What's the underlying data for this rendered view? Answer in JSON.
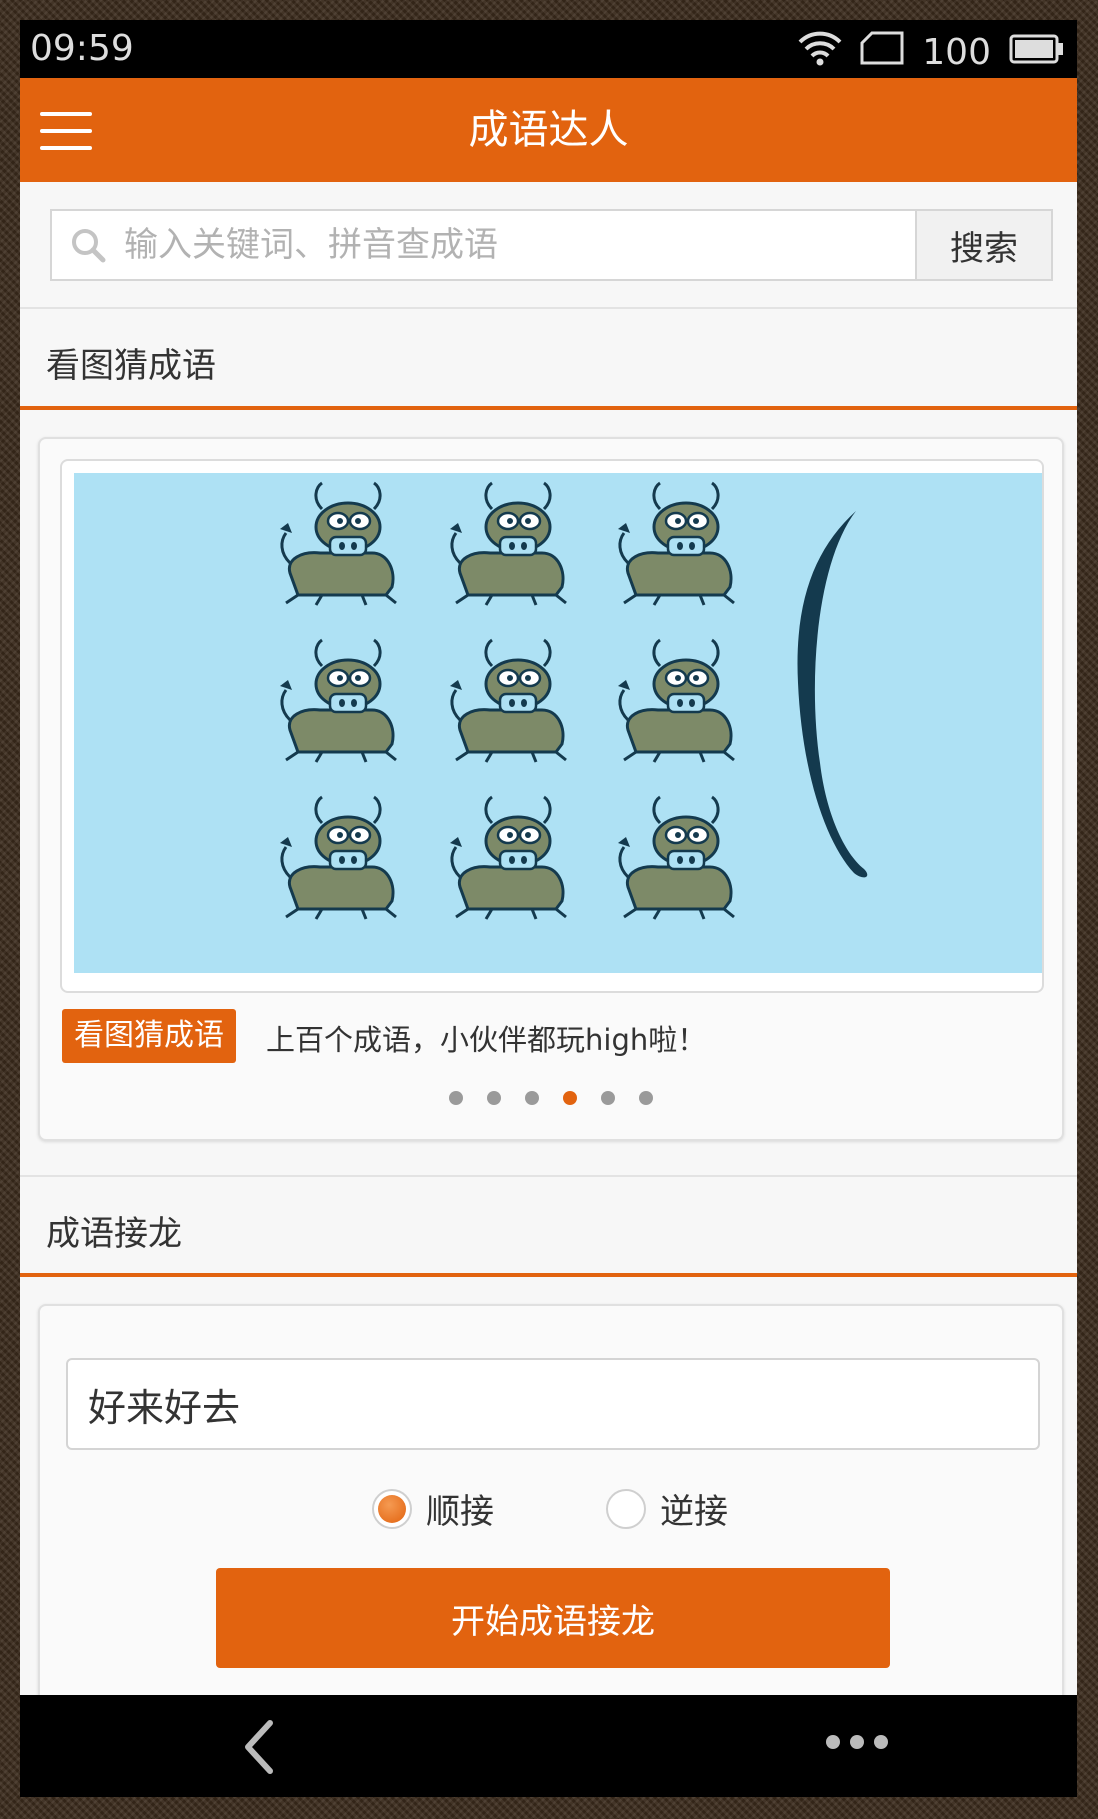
{
  "status_bar": {
    "time": "09:59",
    "battery": "100"
  },
  "header": {
    "title": "成语达人"
  },
  "search": {
    "placeholder": "输入关键词、拼音查成语",
    "button_label": "搜索"
  },
  "section_picture": {
    "title": "看图猜成语",
    "tag": "看图猜成语",
    "caption": "上百个成语，小伙伴都玩high啦！",
    "carousel_page_count": 6,
    "carousel_active_index": 3
  },
  "section_chain": {
    "title": "成语接龙",
    "input_value": "好来好去",
    "options": [
      {
        "label": "顺接",
        "selected": true
      },
      {
        "label": "逆接",
        "selected": false
      }
    ],
    "start_button_label": "开始成语接龙"
  },
  "icons": {
    "menu": "menu-icon",
    "search": "search-icon",
    "wifi": "wifi-icon",
    "sim": "sim-icon",
    "battery": "battery-icon",
    "back": "back-icon",
    "more": "more-icon"
  },
  "colors": {
    "accent": "#e2630f",
    "image_background": "#aee1f4"
  }
}
